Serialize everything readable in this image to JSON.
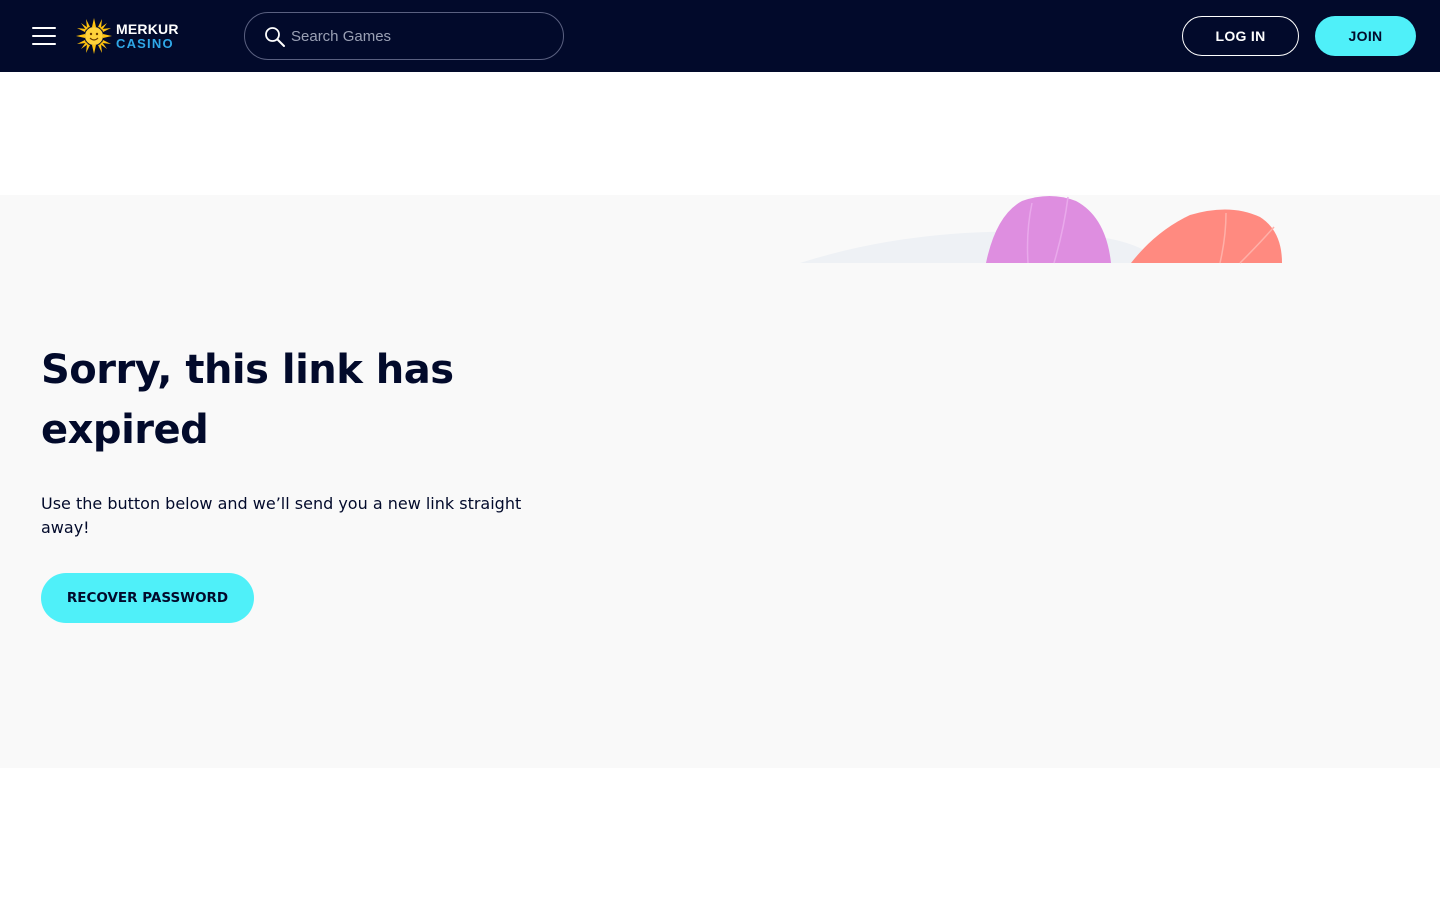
{
  "header": {
    "logo_line1": "MERKUR",
    "logo_line2": "CASINO",
    "search": {
      "placeholder": "Search Games"
    },
    "login_label": "LOG IN",
    "join_label": "JOIN"
  },
  "main": {
    "heading": "Sorry, this link has expired",
    "message": "Use the button below and we’ll send you a new link straight away!",
    "recover_label": "RECOVER PASSWORD"
  },
  "icons": [
    "menu-icon",
    "search-icon",
    "merkur-sun-logo-icon"
  ],
  "colors": {
    "header_bg": "#020a2b",
    "accent": "#4ff0f9",
    "content_bg": "#f9f9f9",
    "text": "#020a2b",
    "logo_blue": "#2fa8e8",
    "decor_pink": "#de8ee0",
    "decor_coral": "#ff8a80"
  }
}
